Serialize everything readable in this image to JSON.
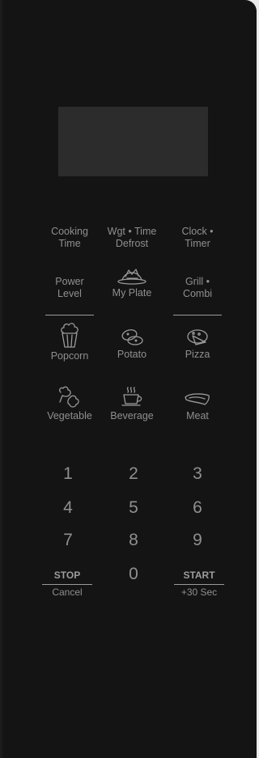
{
  "keys": {
    "cooking_time": [
      "Cooking",
      "Time"
    ],
    "wgt_time_defrost": [
      "Wgt • Time",
      "Defrost"
    ],
    "clock_timer": [
      "Clock •",
      "Timer"
    ],
    "power_level": [
      "Power",
      "Level"
    ],
    "my_plate": "My Plate",
    "grill_combi": [
      "Grill •",
      "Combi"
    ],
    "popcorn": "Popcorn",
    "potato": "Potato",
    "pizza": "Pizza",
    "vegetable": "Vegetable",
    "beverage": "Beverage",
    "meat": "Meat"
  },
  "numpad": [
    "1",
    "2",
    "3",
    "4",
    "5",
    "6",
    "7",
    "8",
    "9",
    "0"
  ],
  "stop": {
    "top": "STOP",
    "bottom": "Cancel"
  },
  "start": {
    "top": "START",
    "bottom": "+30 Sec"
  },
  "icons": {
    "my_plate": "plate-icon",
    "popcorn": "popcorn-icon",
    "potato": "potato-icon",
    "pizza": "pizza-icon",
    "vegetable": "vegetable-icon",
    "beverage": "beverage-icon",
    "meat": "meat-icon"
  },
  "colors": {
    "panel": "#141414",
    "display": "#2c2c2c",
    "text": "#8f8f8f",
    "background": "#ebebeb"
  }
}
